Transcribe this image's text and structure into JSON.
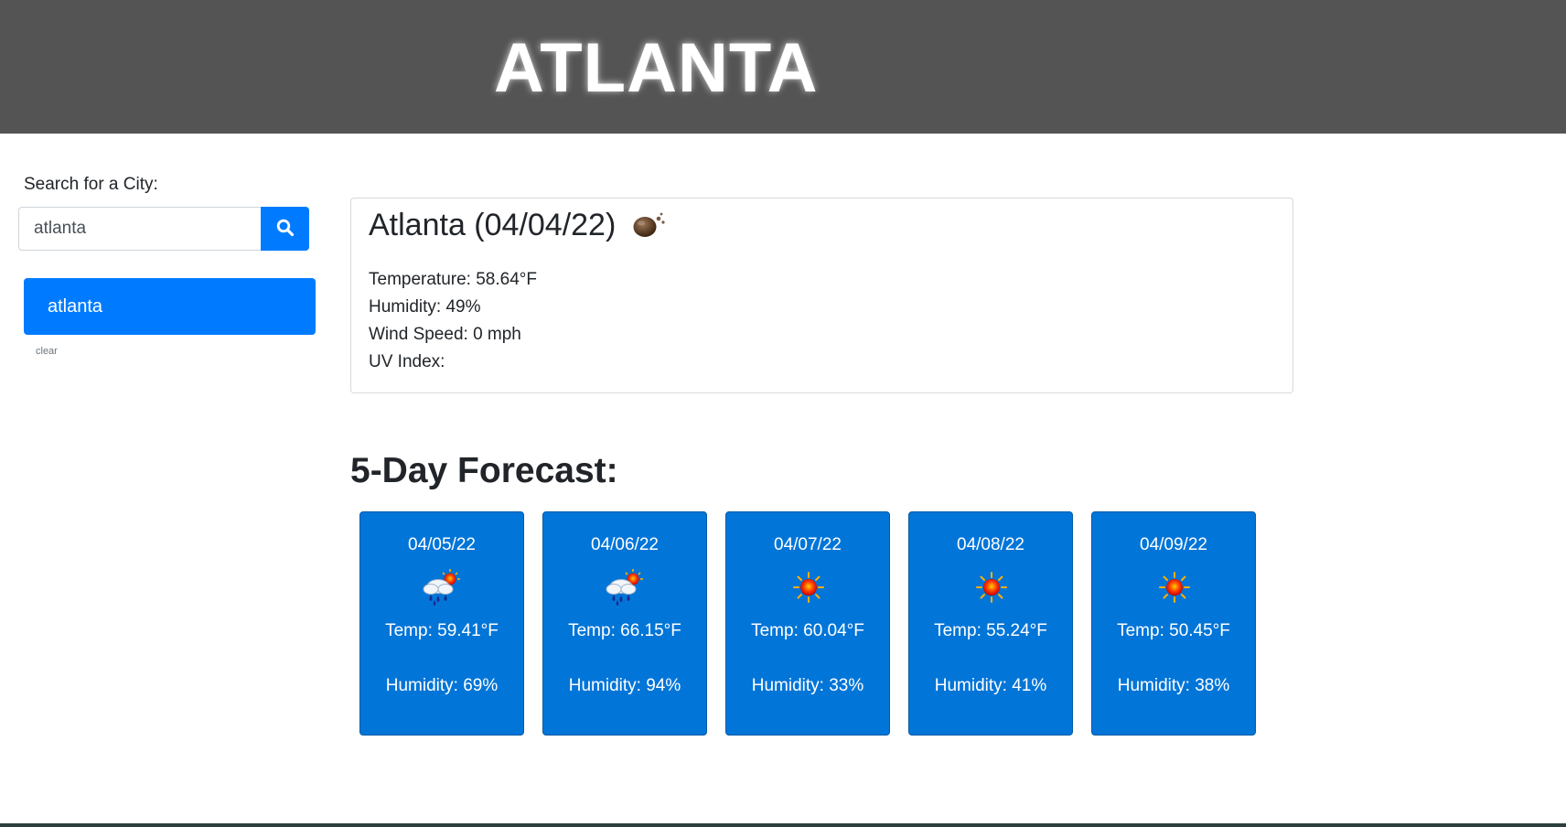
{
  "header": {
    "title": "ATLANTA"
  },
  "search": {
    "label": "Search for a City:",
    "value": "atlanta",
    "button_icon": "search-icon"
  },
  "history": {
    "items": [
      "atlanta"
    ],
    "clear_label": "clear"
  },
  "current": {
    "title": "Atlanta (04/04/22)",
    "icon": "broken-clouds-night-icon",
    "temperature": "Temperature: 58.64°F",
    "humidity": "Humidity: 49%",
    "wind": "Wind Speed: 0 mph",
    "uv": "UV Index:"
  },
  "forecast": {
    "title": "5-Day Forecast:",
    "days": [
      {
        "date": "04/05/22",
        "icon": "rain-sun-icon",
        "temp": "Temp: 59.41°F",
        "humidity": "Humidity: 69%"
      },
      {
        "date": "04/06/22",
        "icon": "rain-sun-icon",
        "temp": "Temp: 66.15°F",
        "humidity": "Humidity: 94%"
      },
      {
        "date": "04/07/22",
        "icon": "sun-icon",
        "temp": "Temp: 60.04°F",
        "humidity": "Humidity: 33%"
      },
      {
        "date": "04/08/22",
        "icon": "sun-icon",
        "temp": "Temp: 55.24°F",
        "humidity": "Humidity: 41%"
      },
      {
        "date": "04/09/22",
        "icon": "sun-icon",
        "temp": "Temp: 50.45°F",
        "humidity": "Humidity: 38%"
      }
    ]
  },
  "colors": {
    "header_bg": "#545454",
    "primary": "#007bff",
    "forecast_card": "#0275d8"
  }
}
